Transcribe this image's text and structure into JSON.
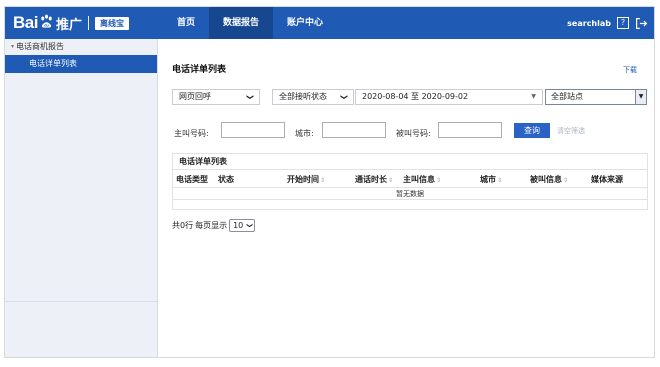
{
  "brand": {
    "logo_left": "Bai",
    "logo_paw_text": "du",
    "logo_right": "推广",
    "badge": "离线宝",
    "primary_color": "#1f5ab5"
  },
  "nav": {
    "items": [
      {
        "label": "首页",
        "active": false
      },
      {
        "label": "数据报告",
        "active": true
      },
      {
        "label": "账户中心",
        "active": false
      }
    ]
  },
  "topbar_right": {
    "username": "searchlab",
    "help_label": "?",
    "logout_icon": "logout-icon"
  },
  "sidebar": {
    "group_label": "电话商机报告",
    "items": [
      {
        "label": "电话详单列表",
        "active": true
      }
    ]
  },
  "main": {
    "title": "电话详单列表",
    "download": "下载",
    "filters": {
      "source_select": "网页回呼",
      "status_select": "全部接听状态",
      "date_range": "2020-08-04 至 2020-09-02",
      "site_select": "全部站点",
      "caller_label": "主叫号码:",
      "caller_value": "",
      "city_label": "城市:",
      "city_value": "",
      "callee_label": "被叫号码:",
      "callee_value": "",
      "query_button": "查询",
      "clear_link": "清空筛选"
    },
    "table": {
      "title": "电话详单列表",
      "columns": [
        "电话类型",
        "状态",
        "开始时间",
        "通话时长",
        "主叫信息",
        "城市",
        "被叫信息",
        "媒体来源"
      ],
      "empty_text": "暂无数据"
    },
    "pager": {
      "total_text": "共0行",
      "per_page_label": "每页显示",
      "per_page_value": "10"
    }
  }
}
